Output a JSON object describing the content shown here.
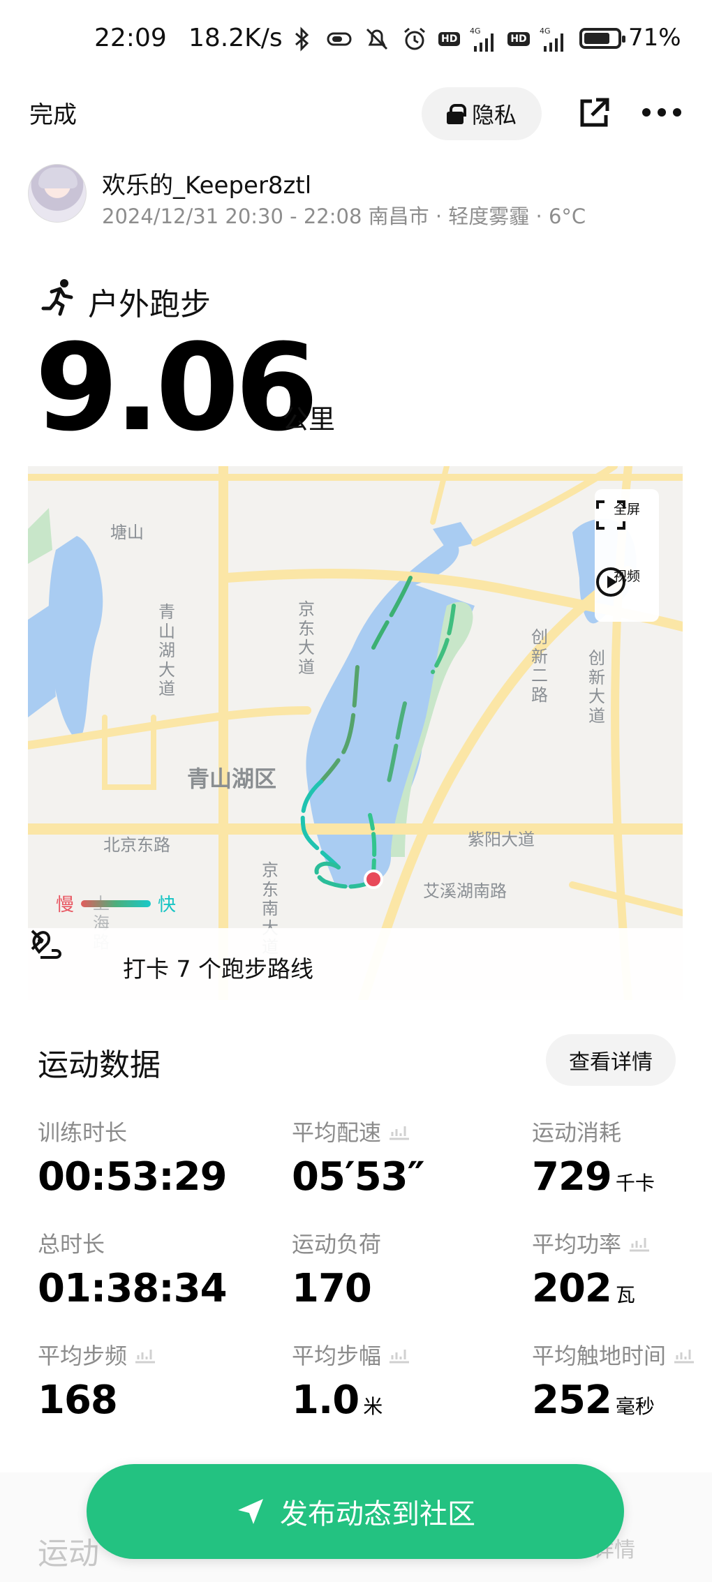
{
  "status_bar": {
    "time": "22:09",
    "speed": "18.2K/s",
    "network_1": "4G",
    "network_2": "4G",
    "hd_label": "HD",
    "battery": "71%"
  },
  "topbar": {
    "done_label": "完成",
    "privacy_label": "隐私"
  },
  "user": {
    "name": "欢乐的_Keeper8ztl",
    "meta": "2024/12/31 20:30 - 22:08 南昌市 · 轻度雾霾 · 6°C"
  },
  "activity": {
    "type": "户外跑步",
    "distance": "9.06",
    "distance_unit": "公里"
  },
  "map": {
    "labels": {
      "tangshan": "塘山",
      "qingshanhu_avenue": "青山湖大道",
      "jingdong_avenue": "京东大道",
      "chuangxin_2": "创新二路",
      "chuangxin_avenue": "创新大道",
      "qingshanhu_district": "青山湖区",
      "beijing_east_road": "北京东路",
      "ziyang_avenue": "紫阳大道",
      "jingdong_south": "京东南大道",
      "aixihu_south": "艾溪湖南路",
      "shanghai_road": "上海路"
    },
    "fullscreen_label": "全屏",
    "video_label": "视频",
    "legend_slow": "慢",
    "legend_fast": "快",
    "checkin_text": "打卡 7 个跑步路线",
    "colors": {
      "water": "#a9ccf2",
      "road": "#fbe6a6",
      "green": "#c8e6c9",
      "track_slow": "#e35c5c",
      "track_fast": "#18c9c9",
      "track_mid": "#4caf7c"
    }
  },
  "stats": {
    "title": "运动数据",
    "detail_button": "查看详情",
    "items": [
      {
        "label": "训练时长",
        "value": "00:53:29",
        "unit": ""
      },
      {
        "label": "平均配速",
        "value": "05′53″",
        "unit": ""
      },
      {
        "label": "运动消耗",
        "value": "729",
        "unit": "千卡"
      },
      {
        "label": "总时长",
        "value": "01:38:34",
        "unit": ""
      },
      {
        "label": "运动负荷",
        "value": "170",
        "unit": ""
      },
      {
        "label": "平均功率",
        "value": "202",
        "unit": "瓦"
      },
      {
        "label": "平均步频",
        "value": "168",
        "unit": ""
      },
      {
        "label": "平均步幅",
        "value": "1.0",
        "unit": "米"
      },
      {
        "label": "平均触地时间",
        "value": "252",
        "unit": "毫秒"
      }
    ]
  },
  "footer": {
    "publish_label": "发布动态到社区",
    "ghost_title": "运动",
    "ghost_detail": "详情"
  }
}
